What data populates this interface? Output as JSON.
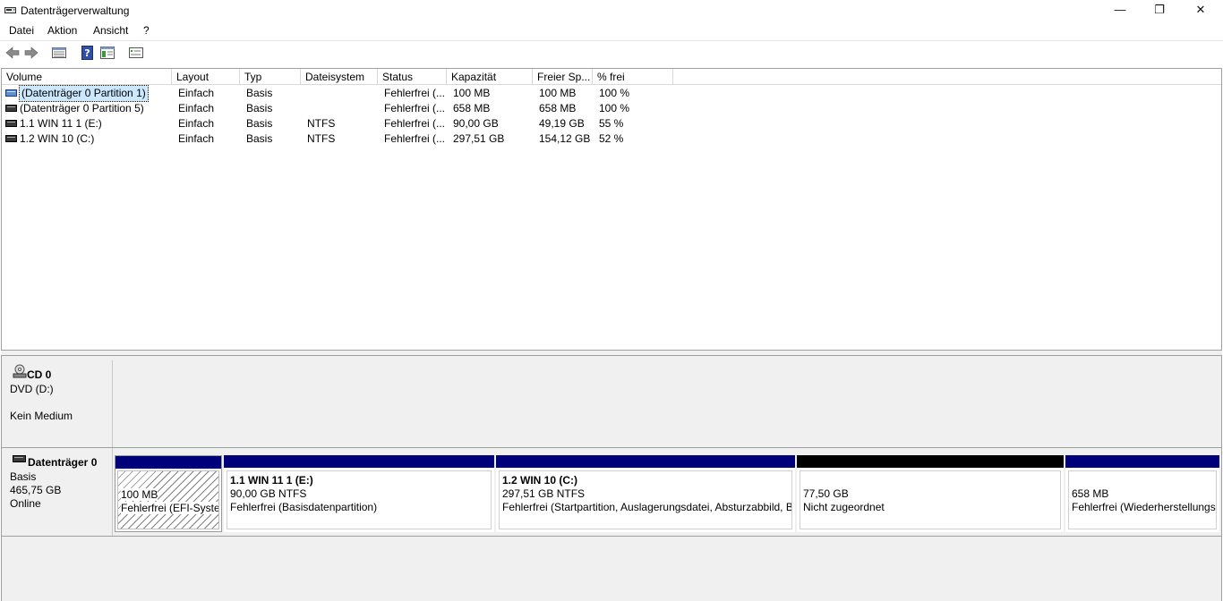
{
  "window": {
    "title": "Datenträgerverwaltung",
    "minimize": "—",
    "maximize": "❐",
    "close": "✕"
  },
  "menu": [
    "Datei",
    "Aktion",
    "Ansicht",
    "?"
  ],
  "toolbar": {
    "buttons": [
      "back-icon",
      "forward-icon",
      "list-view-icon",
      "help-icon",
      "properties-icon",
      "settings-icon"
    ]
  },
  "columns": [
    "Volume",
    "Layout",
    "Typ",
    "Dateisystem",
    "Status",
    "Kapazität",
    "Freier Sp...",
    "% frei"
  ],
  "volumes": [
    {
      "name": "(Datenträger 0 Partition 1)",
      "layout": "Einfach",
      "typ": "Basis",
      "fs": "",
      "status": "Fehlerfrei (...",
      "kapazitaet": "100 MB",
      "frei": "100 MB",
      "prozent": "100 %"
    },
    {
      "name": "(Datenträger 0 Partition 5)",
      "layout": "Einfach",
      "typ": "Basis",
      "fs": "",
      "status": "Fehlerfrei (...",
      "kapazitaet": "658 MB",
      "frei": "658 MB",
      "prozent": "100 %"
    },
    {
      "name": "1.1 WIN 11 1 (E:)",
      "layout": "Einfach",
      "typ": "Basis",
      "fs": "NTFS",
      "status": "Fehlerfrei (...",
      "kapazitaet": "90,00 GB",
      "frei": "49,19 GB",
      "prozent": "55 %"
    },
    {
      "name": "1.2 WIN 10 (C:)",
      "layout": "Einfach",
      "typ": "Basis",
      "fs": "NTFS",
      "status": "Fehlerfrei (...",
      "kapazitaet": "297,51 GB",
      "frei": "154,12 GB",
      "prozent": "52 %"
    }
  ],
  "cd": {
    "name": "CD 0",
    "type": "DVD (D:)",
    "media": "Kein Medium"
  },
  "disk0": {
    "name": "Datenträger 0",
    "type": "Basis",
    "size": "465,75 GB",
    "state": "Online",
    "partitions": [
      {
        "title": "",
        "size": "100 MB",
        "status": "Fehlerfrei (EFI-System"
      },
      {
        "title": "1.1 WIN 11 1  (E:)",
        "size": "90,00 GB NTFS",
        "status": "Fehlerfrei (Basisdatenpartition)"
      },
      {
        "title": "1.2 WIN 10  (C:)",
        "size": "297,51 GB NTFS",
        "status": "Fehlerfrei (Startpartition, Auslagerungsdatei, Absturzabbild, B"
      },
      {
        "title": "",
        "size": "77,50 GB",
        "status": "Nicht zugeordnet"
      },
      {
        "title": "",
        "size": "658 MB",
        "status": "Fehlerfrei (Wiederherstellungs"
      }
    ]
  },
  "colors": {
    "primary_partition": "#00007b",
    "unallocated": "#000000",
    "selection": "#cce8ff"
  }
}
